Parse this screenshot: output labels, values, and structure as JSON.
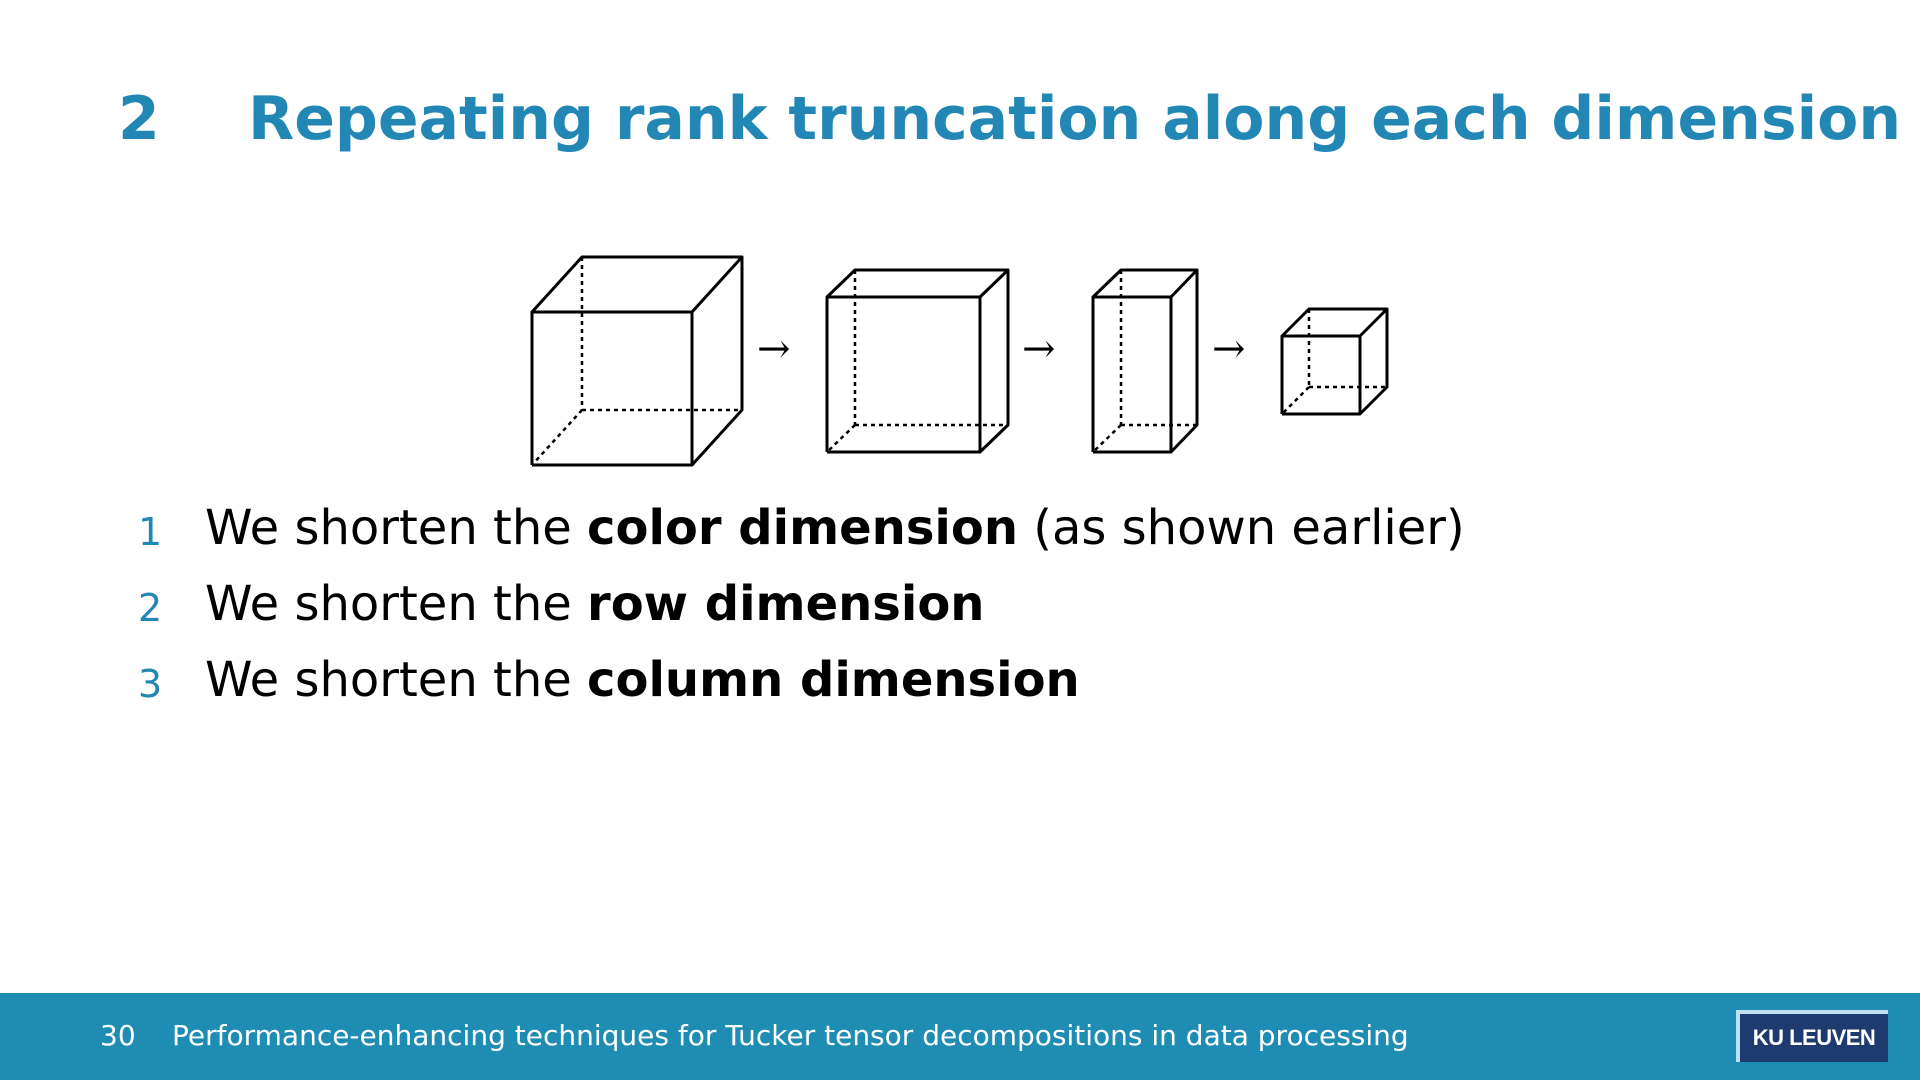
{
  "slide": {
    "section_number": "2",
    "title": "Repeating rank truncation along each dimension"
  },
  "figure": {
    "arrow": "→",
    "cube_count": 4
  },
  "list": [
    {
      "num": "1",
      "prefix": "We shorten the ",
      "bold": "color dimension",
      "suffix": " (as shown earlier)"
    },
    {
      "num": "2",
      "prefix": "We shorten the ",
      "bold": "row dimension",
      "suffix": ""
    },
    {
      "num": "3",
      "prefix": "We shorten the ",
      "bold": "column dimension",
      "suffix": ""
    }
  ],
  "footer": {
    "page_number": "30",
    "title": "Performance-enhancing techniques for Tucker tensor decompositions in data processing",
    "logo_text": "KU LEUVEN"
  },
  "colors": {
    "accent": "#2387b5",
    "footer_bg": "#1f8db3",
    "logo_bg": "#1d3b6e"
  }
}
